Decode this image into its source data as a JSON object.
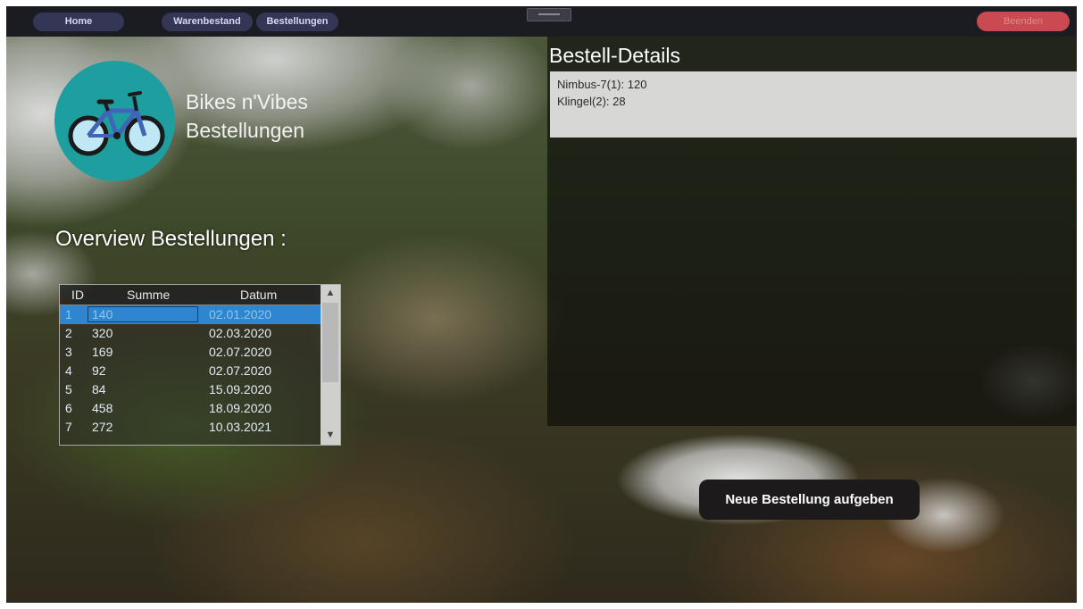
{
  "nav": {
    "home_label": "Home",
    "warenbestand_label": "Warenbestand",
    "bestellungen_label": "Bestellungen",
    "beenden_label": "Beenden"
  },
  "brand": {
    "line1": "Bikes n'Vibes",
    "line2": "Bestellungen",
    "logo_icon": "bicycle-icon"
  },
  "overview": {
    "heading": "Overview Bestellungen :"
  },
  "orders_table": {
    "headers": {
      "id": "ID",
      "summe": "Summe",
      "datum": "Datum"
    },
    "rows": [
      {
        "id": "1",
        "summe": "140",
        "datum": "02.01.2020"
      },
      {
        "id": "2",
        "summe": "320",
        "datum": "02.03.2020"
      },
      {
        "id": "3",
        "summe": "169",
        "datum": "02.07.2020"
      },
      {
        "id": "4",
        "summe": "92",
        "datum": "02.07.2020"
      },
      {
        "id": "5",
        "summe": "84",
        "datum": "15.09.2020"
      },
      {
        "id": "6",
        "summe": "458",
        "datum": "18.09.2020"
      },
      {
        "id": "7",
        "summe": "272",
        "datum": "10.03.2021"
      }
    ],
    "selected_row": 0
  },
  "details": {
    "title": "Bestell-Details",
    "lines": [
      "Nimbus-7(1): 120",
      "Klingel(2): 28"
    ]
  },
  "actions": {
    "new_order_label": "Neue Bestellung aufgeben"
  },
  "colors": {
    "nav_button": "#343656",
    "beenden": "#c94a50",
    "logo_circle": "#1e9e9f",
    "selection": "#2f86d0"
  }
}
